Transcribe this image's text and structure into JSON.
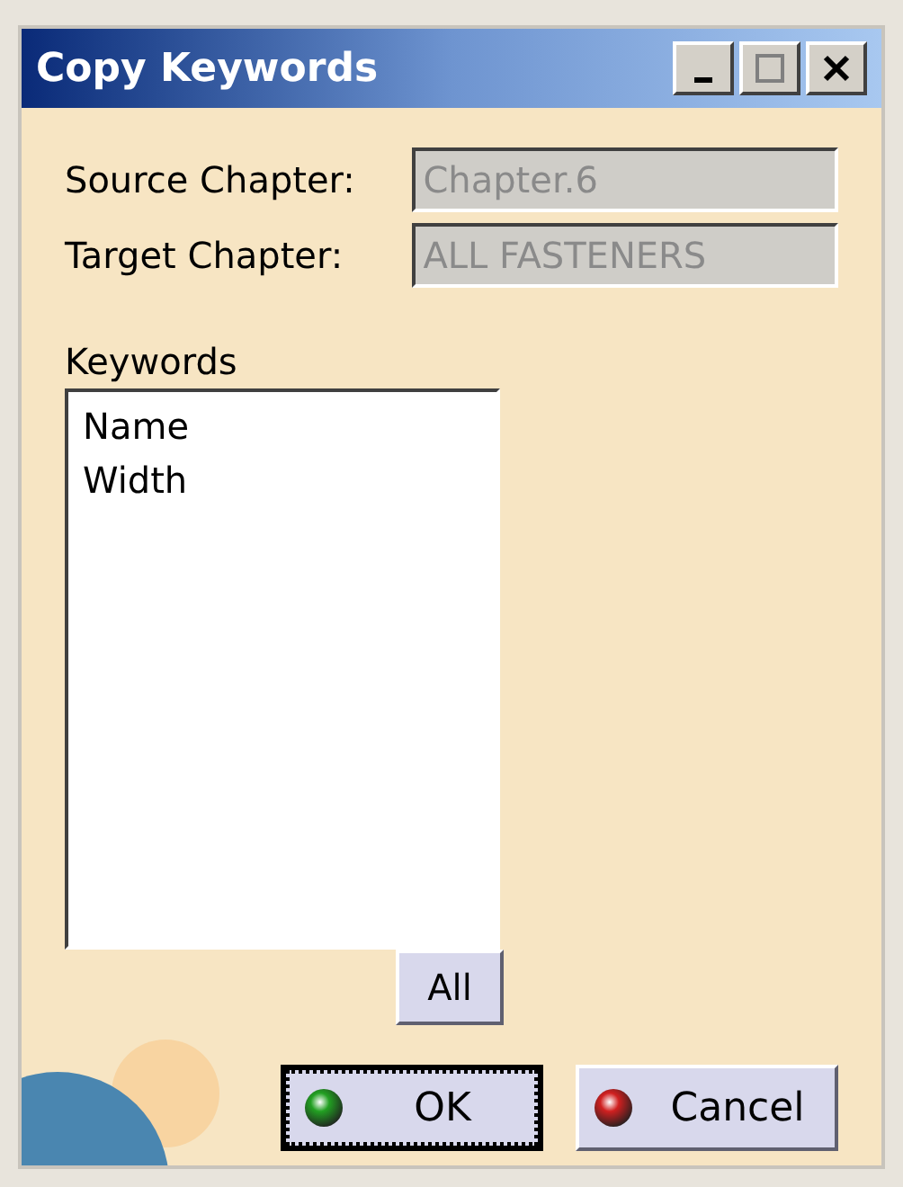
{
  "window": {
    "title": "Copy Keywords"
  },
  "fields": [
    {
      "label": "Source Chapter:",
      "value": "Chapter.6",
      "disabled": true
    },
    {
      "label": "Target Chapter:",
      "value": "ALL FASTENERS",
      "disabled": true
    }
  ],
  "keywords": {
    "label": "Keywords",
    "items": [
      "Name",
      "Width"
    ],
    "all_button": "All"
  },
  "buttons": [
    {
      "label": "OK",
      "default": true,
      "kind": "confirm"
    },
    {
      "label": "Cancel",
      "default": false,
      "kind": "cancel"
    }
  ]
}
